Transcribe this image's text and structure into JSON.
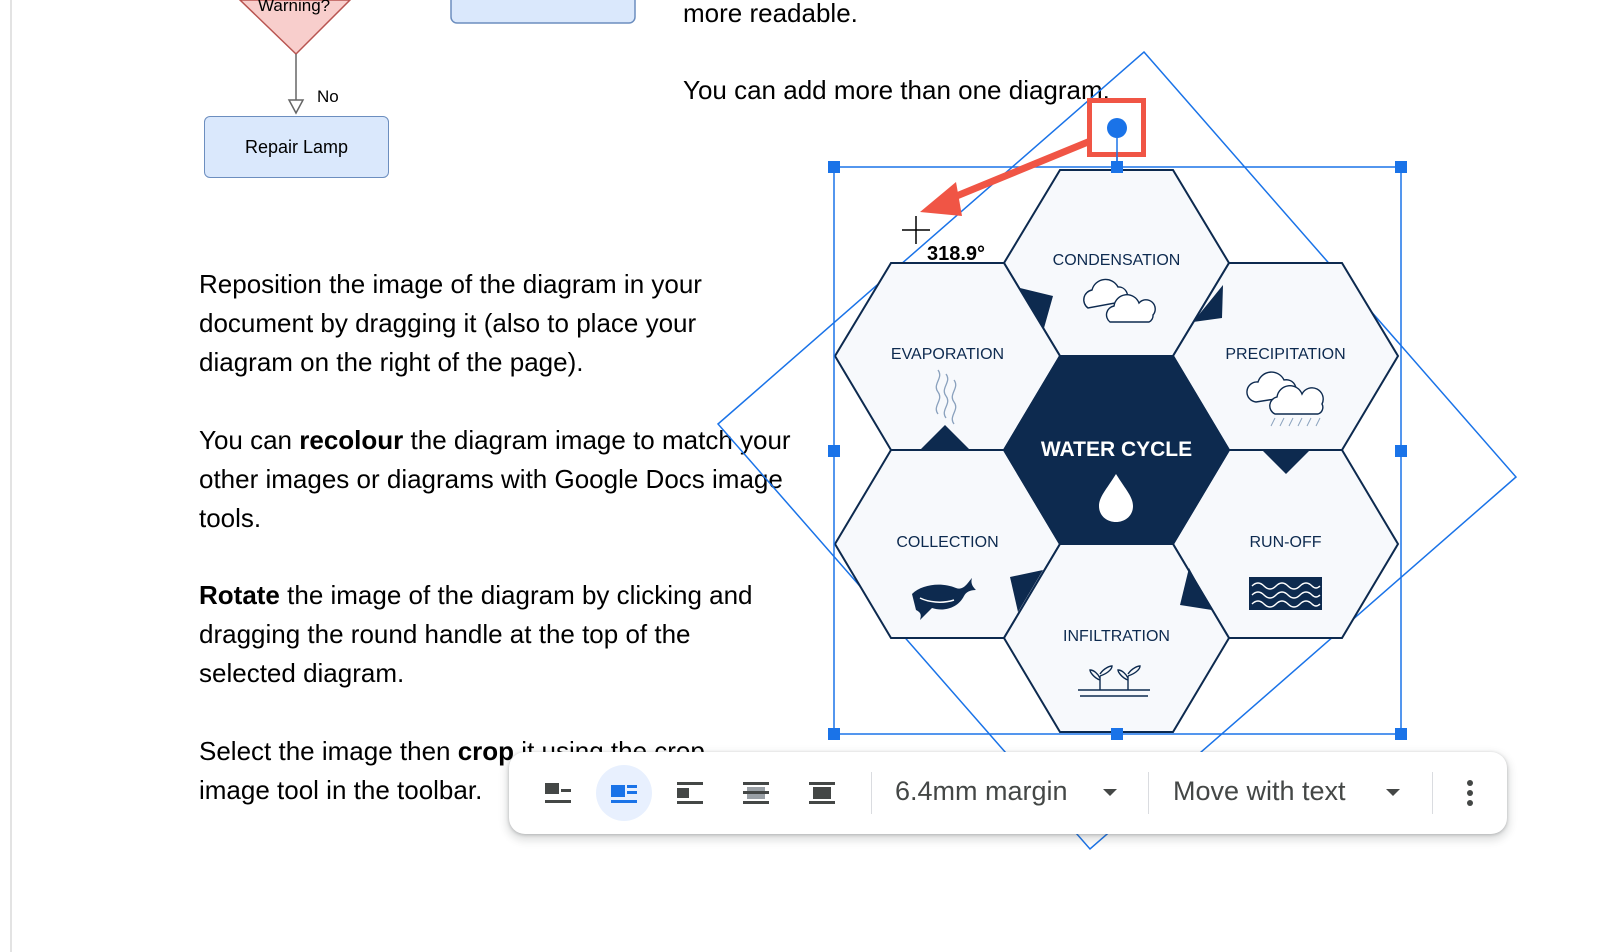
{
  "flowchart": {
    "decision_label": "Warning?",
    "no_label": "No",
    "repair_box": "Repair Lamp"
  },
  "document": {
    "line_top": "more readable.",
    "line_more": "You can add more than one diagram.",
    "para1": "Reposition the image of the diagram in your document by dragging it (also to place your diagram on the right of the page).",
    "para2_bold": "recolour",
    "para2_pre": "You can ",
    "para2_post": " the diagram image to match your other images or diagrams with Google Docs image tools.",
    "para3_bold": "Rotate",
    "para3_post": " the image of the diagram by clicking and dragging the round handle at the top of the selected diagram.",
    "para4_pre": "Select the image then ",
    "para4_bold": "crop",
    "para4_post": " it using the crop",
    "para4_line2": "image tool in the toolbar."
  },
  "diagram": {
    "center": "WATER CYCLE",
    "cells": [
      "CONDENSATION",
      "EVAPORATION",
      "PRECIPITATION",
      "COLLECTION",
      "RUN-OFF",
      "INFILTRATION"
    ],
    "rotation_readout": "318.9°",
    "colors": {
      "navy": "#0d2a4f",
      "cell_fill": "#f5f8fc",
      "selection": "#1a73e8",
      "highlight": "#f05545"
    }
  },
  "toolbar": {
    "wrap_options": [
      "in-line",
      "wrap-text",
      "break-text",
      "behind-text",
      "in-front-of-text"
    ],
    "active_wrap": "wrap-text",
    "margin_label": "6.4mm margin",
    "position_label": "Move with text"
  }
}
